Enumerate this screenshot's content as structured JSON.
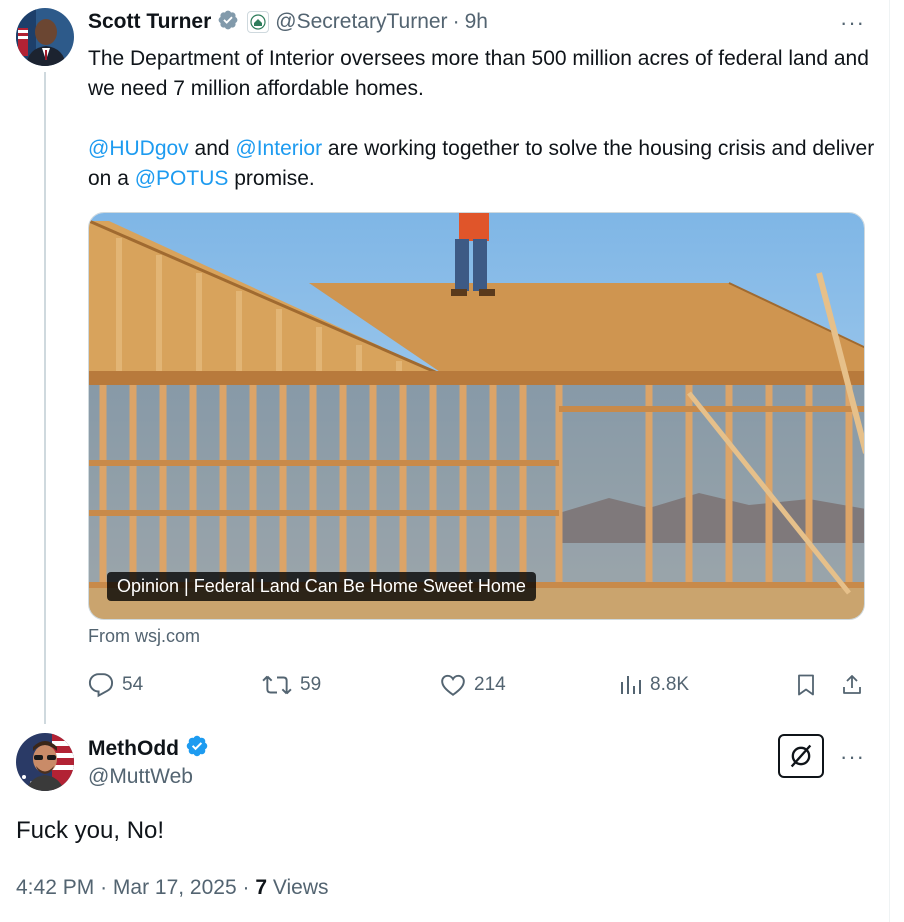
{
  "tweet": {
    "author_name": "Scott Turner",
    "author_handle": "@SecretaryTurner",
    "separator": "·",
    "age": "9h",
    "more_label": "···",
    "paragraph1": "The Department of Interior oversees more than 500 million acres of federal land and we need 7 million affordable homes.",
    "p2_mention1": "@HUDgov",
    "p2_text1": " and ",
    "p2_mention2": "@Interior",
    "p2_text2": " are working together to solve the housing crisis and deliver on a ",
    "p2_mention3": "@POTUS",
    "p2_text3": " promise.",
    "card": {
      "caption": "Opinion | Federal Land Can Be Home Sweet Home",
      "source": "From wsj.com"
    },
    "stats": {
      "replies": "54",
      "reposts": "59",
      "likes": "214",
      "views": "8.8K"
    },
    "icons": [
      "verified-badge-icon",
      "org-badge-icon",
      "more-icon",
      "reply-icon",
      "repost-icon",
      "like-icon",
      "views-icon",
      "bookmark-icon",
      "share-icon"
    ]
  },
  "reply": {
    "author_name": "MethOdd",
    "author_handle": "@MuttWeb",
    "more_label": "···",
    "text": "Fuck you, No!",
    "time": "4:42 PM",
    "separator": "·",
    "date": "Mar 17, 2025",
    "views_count": "7",
    "views_label": " Views",
    "icons": [
      "verified-check-icon",
      "grok-icon"
    ]
  },
  "colors": {
    "accent": "#1d9bf0",
    "muted": "#536471",
    "verified_gray": "#829aab"
  }
}
